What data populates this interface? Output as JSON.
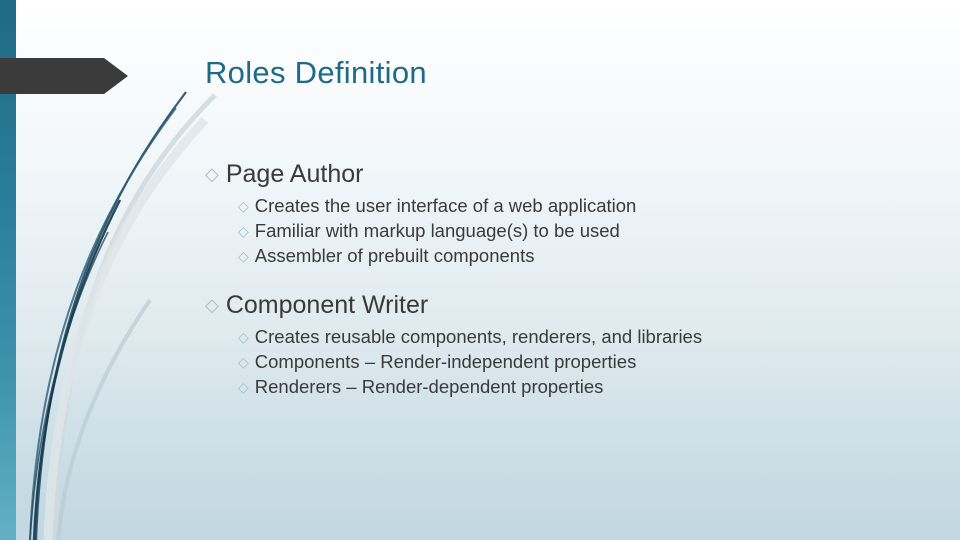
{
  "slide": {
    "title": "Roles Definition",
    "bullet_glyph": "◇",
    "accent_color": "#1f6a86",
    "bullet_color": "#9fbfcc",
    "text_color": "#3a3a3a",
    "groups": [
      {
        "heading": "Page Author",
        "items": [
          "Creates the user interface of a web application",
          "Familiar with markup language(s) to be used",
          "Assembler of prebuilt components"
        ]
      },
      {
        "heading": "Component Writer",
        "items": [
          "Creates reusable components, renderers, and libraries",
          "Components – Render-independent properties",
          "Renderers – Render-dependent properties"
        ]
      }
    ]
  }
}
